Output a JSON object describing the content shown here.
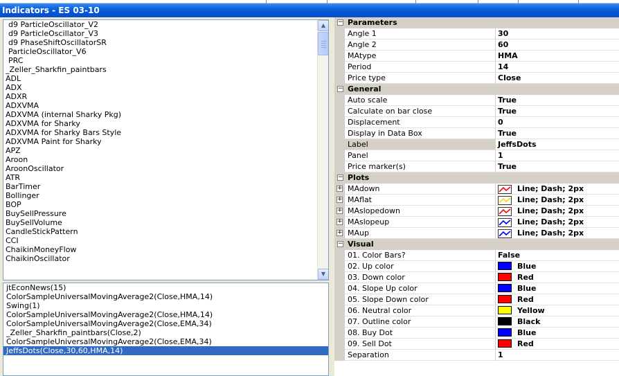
{
  "window": {
    "title": "Indicators - ES 03-10"
  },
  "indicator_list": {
    "items": [
      "d9 ParticleOscillator_V2",
      "d9 ParticleOscillator_V3",
      "d9 PhaseShiftOscillatorSR",
      "ParticleOscillator_V6",
      "PRC",
      "_Zeller_Sharkfin_paintbars",
      "ADL",
      "ADX",
      "ADXR",
      "ADXVMA",
      "ADXVMA (internal Sharky Pkg)",
      "ADXVMA for Sharky",
      "ADXVMA for Sharky Bars Style",
      "ADXVMA Paint for Sharky",
      "APZ",
      "Aroon",
      "AroonOscillator",
      "ATR",
      "BarTimer",
      "Bollinger",
      "BOP",
      "BuySellPressure",
      "BuySellVolume",
      "CandleStickPattern",
      "CCI",
      "ChaikinMoneyFlow",
      "ChaikinOscillator"
    ]
  },
  "applied_list": {
    "items": [
      "jtEconNews(15)",
      "ColorSampleUniversalMovingAverage2(Close,HMA,14)",
      "Swing(1)",
      "ColorSampleUniversalMovingAverage2(Close,HMA,14)",
      "ColorSampleUniversalMovingAverage2(Close,EMA,34)",
      "_Zeller_Sharkfin_paintbars(Close,2)",
      "ColorSampleUniversalMovingAverage2(Close,EMA,34)",
      "JeffsDots(Close,30,60,HMA,14)"
    ],
    "selected_index": 7
  },
  "properties": {
    "categories": [
      {
        "name": "Parameters",
        "expander": "−",
        "rows": [
          {
            "name": "Angle 1",
            "value": "30"
          },
          {
            "name": "Angle 2",
            "value": "60"
          },
          {
            "name": "MAtype",
            "value": "HMA"
          },
          {
            "name": "Period",
            "value": "14"
          },
          {
            "name": "Price type",
            "value": "Close"
          }
        ]
      },
      {
        "name": "General",
        "expander": "−",
        "rows": [
          {
            "name": "Auto scale",
            "value": "True"
          },
          {
            "name": "Calculate on bar close",
            "value": "True"
          },
          {
            "name": "Displacement",
            "value": "0"
          },
          {
            "name": "Display in Data Box",
            "value": "True"
          },
          {
            "name": "Label",
            "value": "JeffsDots",
            "highlight": true
          },
          {
            "name": "Panel",
            "value": "1"
          },
          {
            "name": "Price marker(s)",
            "value": "True"
          }
        ]
      },
      {
        "name": "Plots",
        "expander": "−",
        "rows": [
          {
            "name": "MAdown",
            "value": "Line; Dash; 2px",
            "plot_color": "#ff0000",
            "expander": "+"
          },
          {
            "name": "MAflat",
            "value": "Line; Dash; 2px",
            "plot_color": "#ffd700",
            "expander": "+"
          },
          {
            "name": "MAslopedown",
            "value": "Line; Dash; 2px",
            "plot_color": "#ff0000",
            "expander": "+"
          },
          {
            "name": "MAslopeup",
            "value": "Line; Dash; 2px",
            "plot_color": "#0000ff",
            "expander": "+"
          },
          {
            "name": "MAup",
            "value": "Line; Dash; 2px",
            "plot_color": "#0000ff",
            "expander": "+"
          }
        ]
      },
      {
        "name": "Visual",
        "expander": "−",
        "rows": [
          {
            "name": "01. Color Bars?",
            "value": "False"
          },
          {
            "name": "02. Up color",
            "value": "Blue",
            "color": "#0000ff"
          },
          {
            "name": "03. Down color",
            "value": "Red",
            "color": "#ff0000"
          },
          {
            "name": "04. Slope Up color",
            "value": "Blue",
            "color": "#0000ff"
          },
          {
            "name": "05. Slope Down color",
            "value": "Red",
            "color": "#ff0000"
          },
          {
            "name": "06. Neutral color",
            "value": "Yellow",
            "color": "#ffff00"
          },
          {
            "name": "07. Outline color",
            "value": "Black",
            "color": "#000000"
          },
          {
            "name": "08. Buy Dot",
            "value": "Blue",
            "color": "#0000ff"
          },
          {
            "name": "09. Sell Dot",
            "value": "Red",
            "color": "#ff0000"
          },
          {
            "name": "Separation",
            "value": "1"
          }
        ]
      }
    ]
  },
  "icons": {
    "scroll_up": "▲",
    "scroll_down": "▼"
  }
}
